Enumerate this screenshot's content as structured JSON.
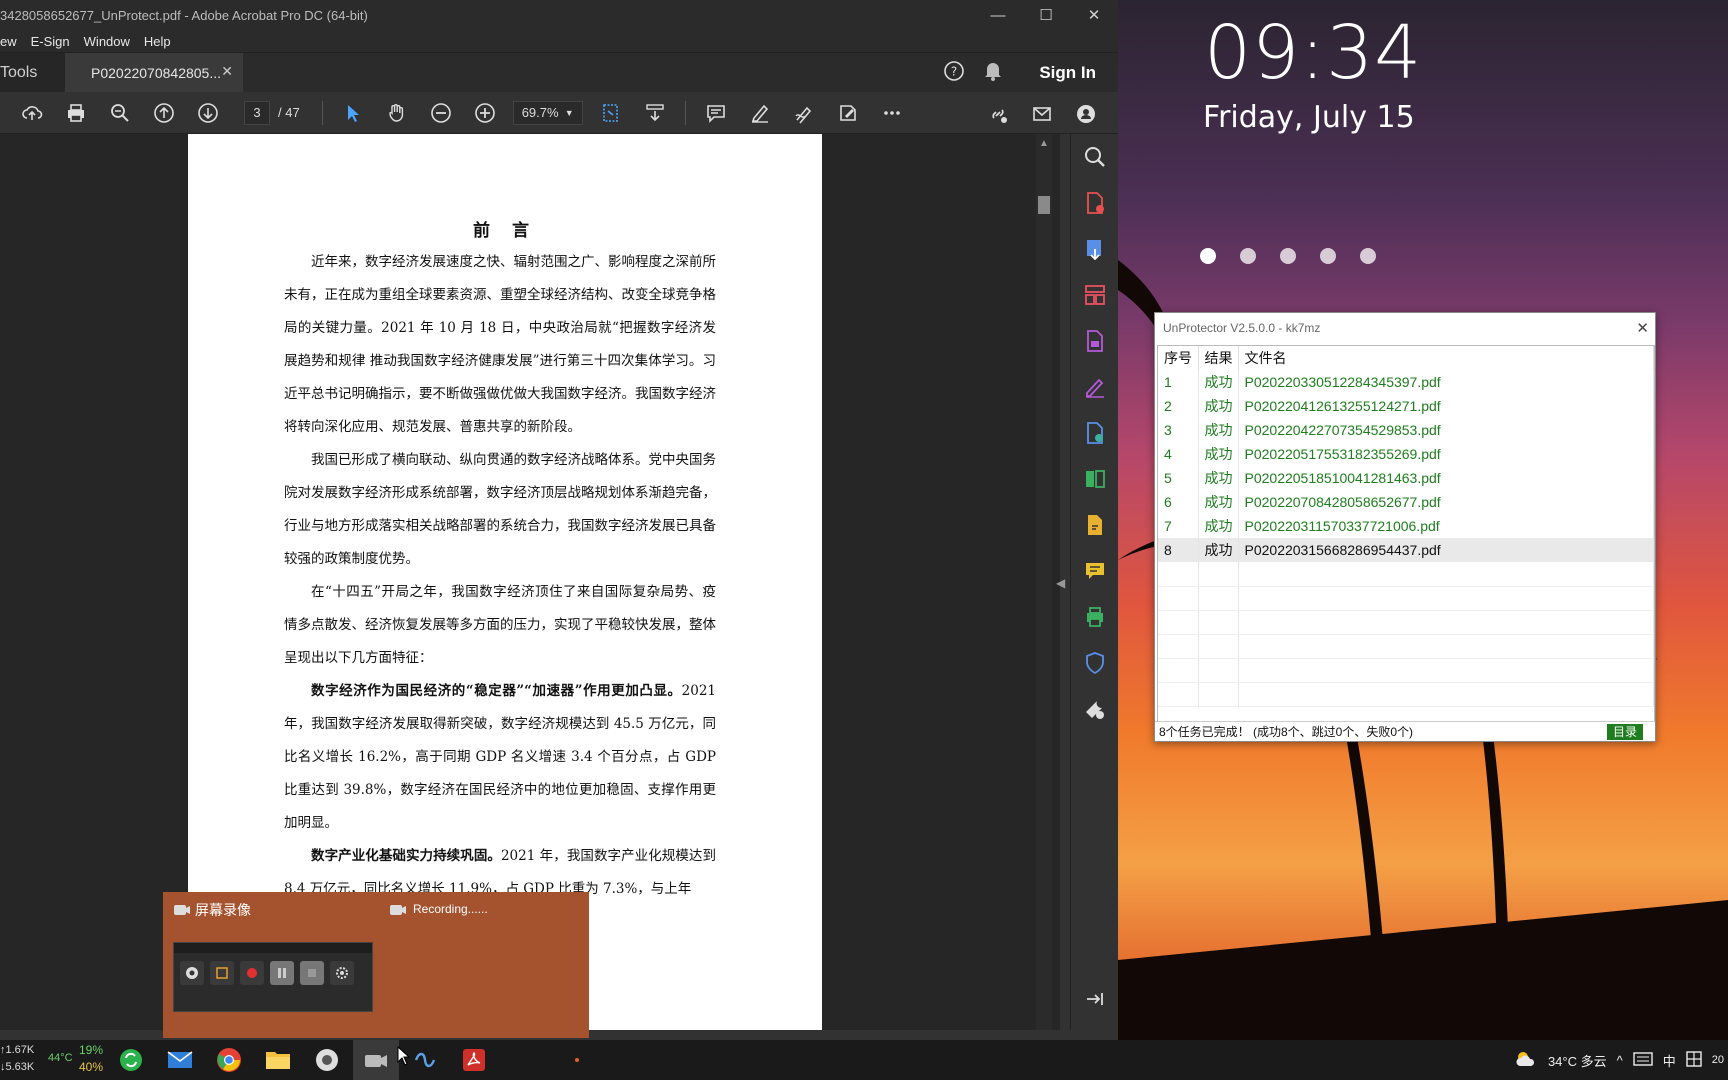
{
  "desktop": {
    "clock_time": "09:34",
    "clock_date": "Friday, July 15"
  },
  "acrobat": {
    "window_title": "3428058652677_UnProtect.pdf - Adobe Acrobat Pro DC (64-bit)",
    "menu": [
      "ew",
      "E-Sign",
      "Window",
      "Help"
    ],
    "tab_tools": "Tools",
    "tab_doc": "P02022070842805...",
    "sign_in": "Sign In",
    "page_current": "3",
    "page_total": "/ 47",
    "zoom": "69.7%"
  },
  "document": {
    "title": "前 言",
    "paragraphs": [
      "近年来，数字经济发展速度之快、辐射范围之广、影响程度之深前所未有，正在成为重组全球要素资源、重塑全球经济结构、改变全球竞争格局的关键力量。2021 年 10 月 18 日，中央政治局就“把握数字经济发展趋势和规律 推动我国数字经济健康发展”进行第三十四次集体学习。习近平总书记明确指示，要不断做强做优做大我国数字经济。我国数字经济将转向深化应用、规范发展、普惠共享的新阶段。",
      "我国已形成了横向联动、纵向贯通的数字经济战略体系。党中央国务院对发展数字经济形成系统部署，数字经济顶层战略规划体系渐趋完备，行业与地方形成落实相关战略部署的系统合力，我国数字经济发展已具备较强的政策制度优势。",
      "在“十四五”开局之年，我国数字经济顶住了来自国际复杂局势、疫情多点散发、经济恢复发展等多方面的压力，实现了平稳较快发展，整体呈现出以下几方面特征："
    ],
    "para4_bold": "数字经济作为国民经济的“稳定器”“加速器”作用更加凸显。",
    "para4_rest": "2021 年，我国数字经济发展取得新突破，数字经济规模达到 45.5 万亿元，同比名义增长 16.2%，高于同期 GDP 名义增速 3.4 个百分点，占 GDP 比重达到 39.8%，数字经济在国民经济中的地位更加稳固、支撑作用更加明显。",
    "para5_bold": "数字产业化基础实力持续巩固。",
    "para5_rest": "2021 年，我国数字产业化规模达到 8.4 万亿元，同比名义增长 11.9%，占 GDP 比重为 7.3%，与上年"
  },
  "recording": {
    "label_cn": "屏幕录像",
    "label_status": "Recording......"
  },
  "unprotector": {
    "title": "UnProtector V2.5.0.0 - kk7mz",
    "headers": [
      "序号",
      "结果",
      "文件名"
    ],
    "rows": [
      {
        "no": "1",
        "result": "成功",
        "file": "P020220330512284345397.pdf"
      },
      {
        "no": "2",
        "result": "成功",
        "file": "P020220412613255124271.pdf"
      },
      {
        "no": "3",
        "result": "成功",
        "file": "P020220422707354529853.pdf"
      },
      {
        "no": "4",
        "result": "成功",
        "file": "P020220517553182355269.pdf"
      },
      {
        "no": "5",
        "result": "成功",
        "file": "P020220518510041281463.pdf"
      },
      {
        "no": "6",
        "result": "成功",
        "file": "P020220708428058652677.pdf"
      },
      {
        "no": "7",
        "result": "成功",
        "file": "P020220311570337721006.pdf"
      },
      {
        "no": "8",
        "result": "成功",
        "file": "P020220315668286954437.pdf"
      }
    ],
    "status": "8个任务已完成！ (成功8个、跳过0个、失败0个)",
    "dir_button": "目录"
  },
  "taskbar": {
    "net_up": "↑1.67K",
    "net_down": "↓5.63K",
    "cpu_temp": "44°C",
    "cpu_pct": "19%",
    "mem_pct": "40%",
    "weather": "34°C 多云",
    "ime": "中",
    "year": "20"
  },
  "colors": {
    "acrobat_bg": "#323232",
    "success_green": "#1e7d1e",
    "rec_orange": "#a5532e"
  }
}
